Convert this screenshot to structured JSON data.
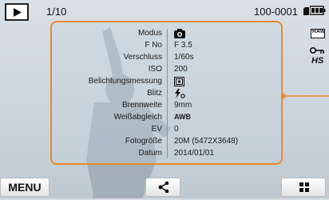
{
  "status": {
    "counter": "1/10",
    "file_number": "100-0001"
  },
  "info_rows": [
    {
      "label": "Modus",
      "value": "",
      "icon": "camera-mode-icon"
    },
    {
      "label": "F No",
      "value": "F 3.5"
    },
    {
      "label": "Verschluss",
      "value": "1/60s"
    },
    {
      "label": "ISO",
      "value": "200"
    },
    {
      "label": "Belichtungsmessung",
      "value": "",
      "icon": "metering-icon"
    },
    {
      "label": "Blitz",
      "value": "",
      "icon": "flash-icon"
    },
    {
      "label": "Brennweite",
      "value": "9mm"
    },
    {
      "label": "Weißabgleich",
      "value": "AWB"
    },
    {
      "label": "EV",
      "value": "0"
    },
    {
      "label": "Fotogröße",
      "value": "20M (5472X3648)"
    },
    {
      "label": "Datum",
      "value": "2014/01/01"
    }
  ],
  "side_indicators": {
    "raw": "RAW",
    "hs": "HS"
  },
  "buttons": {
    "menu": "MENU"
  },
  "colors": {
    "accent": "#e88a2a",
    "panel_border": "#e88a2a"
  },
  "icons": [
    "play-icon",
    "memory-card-icon",
    "battery-icon",
    "raw-icon",
    "protect-key-icon",
    "hs-icon",
    "share-icon",
    "thumbnail-grid-icon"
  ]
}
